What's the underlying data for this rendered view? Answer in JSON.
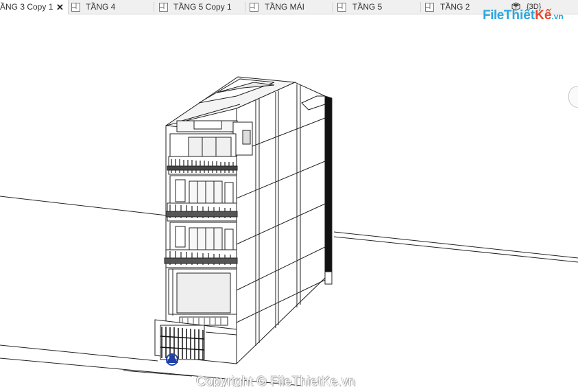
{
  "tabs": [
    {
      "label": "ẦNG 3 Copy 1",
      "active": true,
      "closable": true
    },
    {
      "label": "TẦNG 4",
      "active": false
    },
    {
      "label": "TẦNG 5 Copy 1",
      "active": false
    },
    {
      "label": "TẦNG MÁI",
      "active": false
    },
    {
      "label": "TẦNG 5",
      "active": false
    },
    {
      "label": "TẦNG 2",
      "active": false
    },
    {
      "label": "{3D}",
      "active": false
    }
  ],
  "tab_icons": [
    "floor-plan-icon",
    "3d-view-icon",
    "close-icon"
  ],
  "logo": {
    "file": "File",
    "thiet": "Thiết",
    "ke": "Kế",
    "vn": ".vn"
  },
  "watermark": "Copyright © FileThietKe.vn",
  "colors": {
    "logo_blue": "#29a8e0",
    "logo_red": "#e8462a",
    "tabbar": "#f0f0f0"
  }
}
